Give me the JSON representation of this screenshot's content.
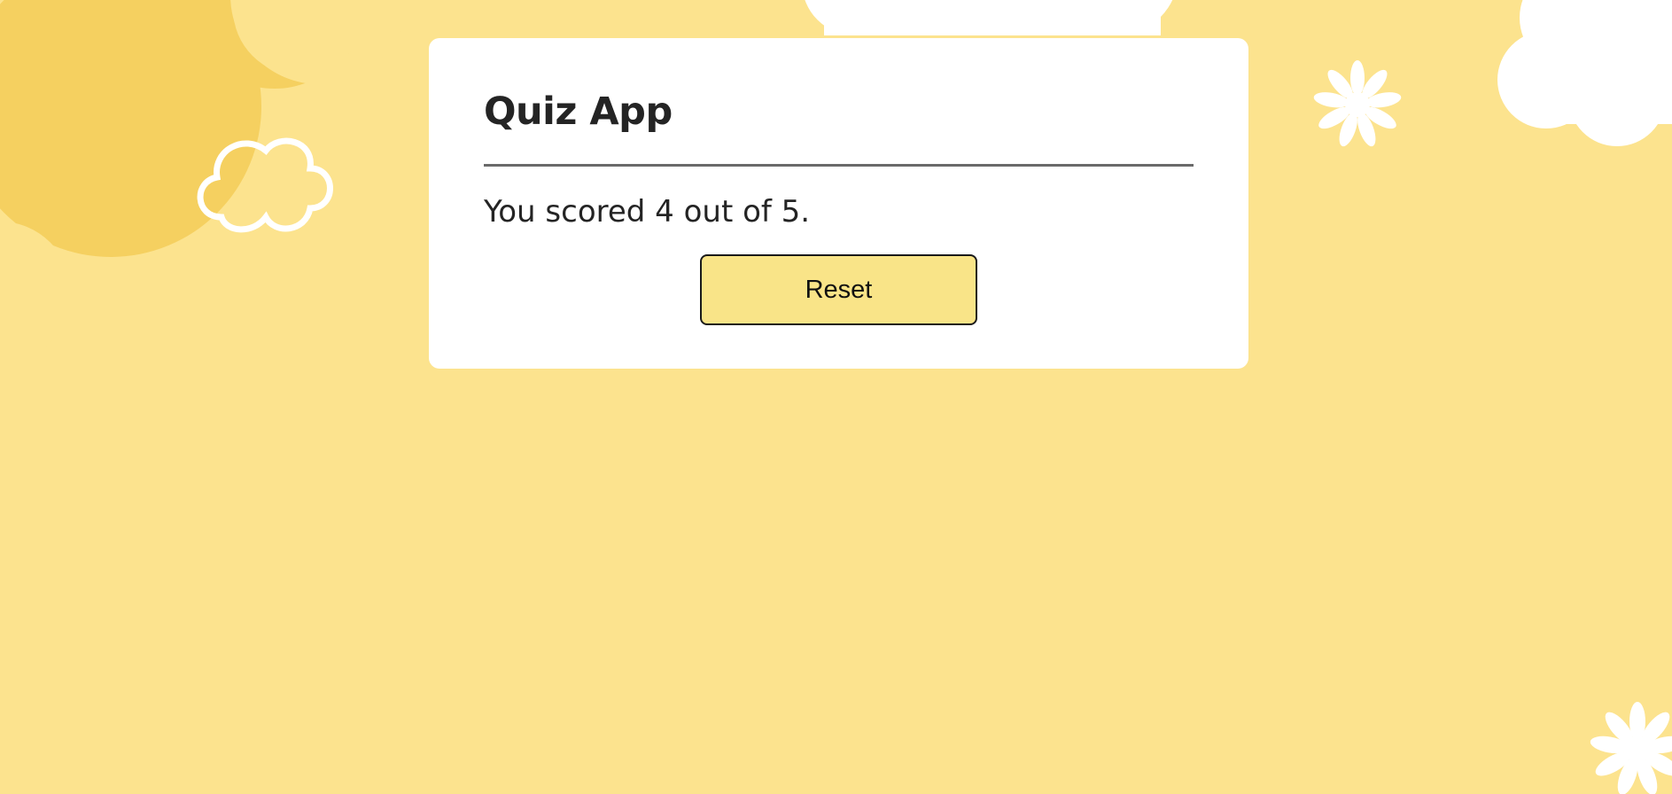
{
  "app": {
    "title": "Quiz App"
  },
  "result": {
    "score_text": "You scored 4 out of 5.",
    "score": 4,
    "total": 5
  },
  "actions": {
    "reset_label": "Reset"
  },
  "colors": {
    "background": "#fce38e",
    "card": "#ffffff",
    "button": "#f9e488",
    "sun": "#f5d060",
    "text": "#242424"
  },
  "icons": [
    "sun-shape",
    "cloud-outline-icon",
    "cloud-icon",
    "flower-icon"
  ]
}
